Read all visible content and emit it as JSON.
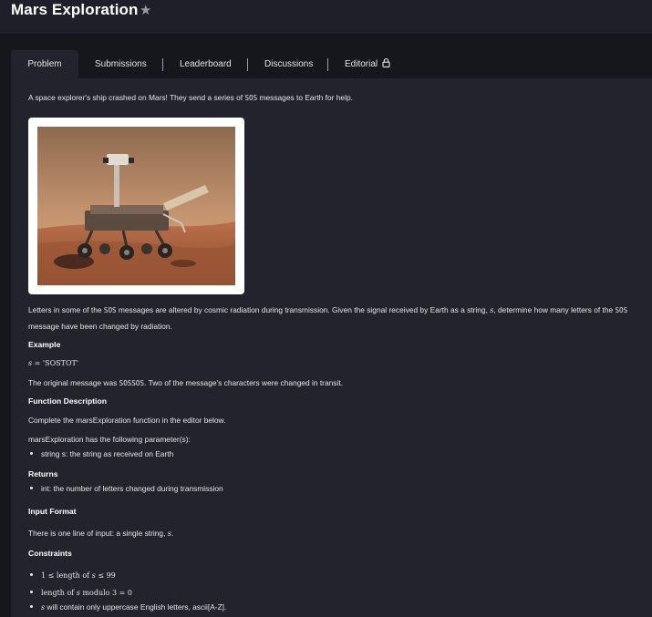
{
  "header": {
    "title": "Mars Exploration",
    "favorite_icon": "star-icon"
  },
  "tabs": [
    {
      "label": "Problem",
      "active": true
    },
    {
      "label": "Submissions",
      "active": false
    },
    {
      "label": "Leaderboard",
      "active": false
    },
    {
      "label": "Discussions",
      "active": false
    },
    {
      "label": "Editorial",
      "active": false,
      "icon": "lock-icon"
    }
  ],
  "problem": {
    "intro_a": "A space explorer's ship crashed on Mars! They send a series of ",
    "intro_code": "SOS",
    "intro_b": " messages to Earth for help.",
    "image_alt": "mars rover",
    "para1_a": "Letters in some of the ",
    "para1_code1": "SOS",
    "para1_b": " messages are altered by cosmic radiation during transmission. Given the signal received by Earth as a string, ",
    "para1_var": "s",
    "para1_c": ", determine how many letters of the ",
    "para1_code2": "SOS",
    "para1_line2": "message have been changed by radiation.",
    "example_heading": "Example",
    "example_var": "s",
    "example_eq": " = 'SOSTOT'",
    "example_text_a": "The original message was ",
    "example_code": "SOSSOS",
    "example_text_b": ". Two of the message's characters were changed in transit.",
    "function_heading": "Function Description",
    "function_text": "Complete the marsExploration function in the editor below.",
    "params_text": "marsExploration has the following parameter(s):",
    "param1": "string s: the string as received on Earth",
    "returns_heading": "Returns",
    "returns1": "int: the number of letters changed during transmission",
    "input_heading": "Input Format",
    "input_text_a": "There is one line of input: a single string, ",
    "input_var": "s",
    "input_text_b": ".",
    "constraints_heading": "Constraints",
    "c1_a": "1 ≤  length of ",
    "c1_var": "s",
    "c1_b": " ≤ 99",
    "c2_a": "length of ",
    "c2_var": "s",
    "c2_b": " modulo  3 = 0",
    "c3_var": "s",
    "c3_text": " will contain only uppercase English letters, ascii[A-Z]."
  }
}
